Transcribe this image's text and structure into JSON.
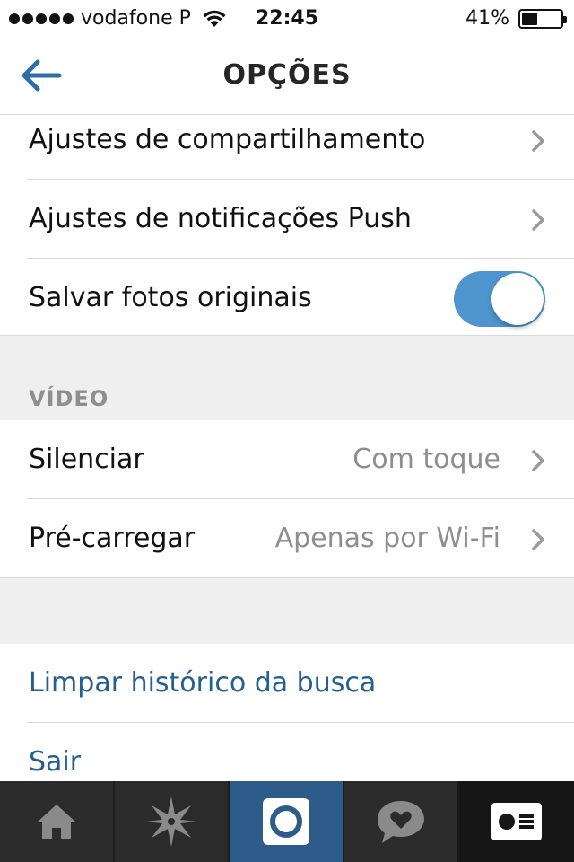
{
  "status_bar": {
    "carrier": "vodafone P",
    "time": "22:45",
    "battery_percent": "41%",
    "battery_level": 0.41
  },
  "nav": {
    "title": "OPÇÕES",
    "back_icon": "arrow-left-icon"
  },
  "rows_top": [
    {
      "label": "Ajustes de compartilhamento",
      "icon": "chevron-right-icon"
    },
    {
      "label": "Ajustes de notificações Push",
      "icon": "chevron-right-icon"
    },
    {
      "label": "Salvar fotos originais",
      "toggle_on": true
    }
  ],
  "video_section": {
    "header": "VÍDEO",
    "rows": [
      {
        "label": "Silenciar",
        "value": "Com toque",
        "icon": "chevron-right-icon"
      },
      {
        "label": "Pré-carregar",
        "value": "Apenas por Wi-Fi",
        "icon": "chevron-right-icon"
      }
    ]
  },
  "actions": [
    {
      "label": "Limpar histórico da busca"
    },
    {
      "label": "Sair"
    }
  ],
  "tab_bar": {
    "tabs": [
      {
        "icon": "home-icon"
      },
      {
        "icon": "explore-star-icon"
      },
      {
        "icon": "camera-icon",
        "active": true
      },
      {
        "icon": "activity-heart-icon"
      },
      {
        "icon": "profile-card-icon"
      }
    ]
  },
  "colors": {
    "accent": "#4e95d0",
    "link": "#245f91",
    "active_tab": "#2e5c8a",
    "tab_bar": "#2a2a2a",
    "section_bg": "#efefef",
    "secondary_text": "#8e8e8e"
  }
}
